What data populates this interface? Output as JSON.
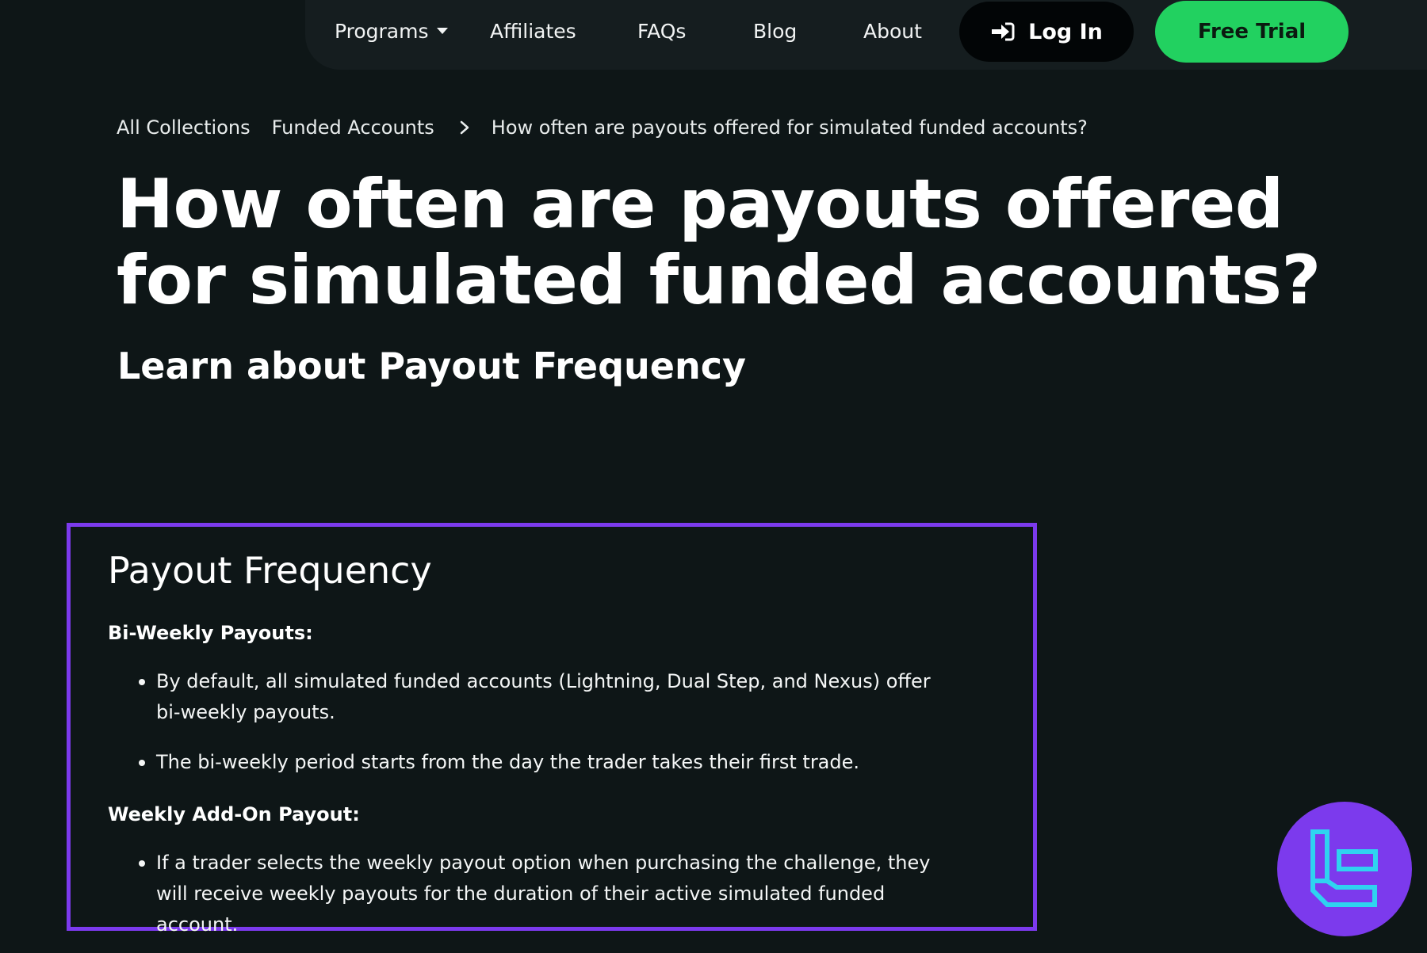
{
  "nav": {
    "items": [
      {
        "label": "Programs",
        "has_dropdown": true
      },
      {
        "label": "Affiliates"
      },
      {
        "label": "FAQs"
      },
      {
        "label": "Blog"
      },
      {
        "label": "About"
      }
    ],
    "login_label": "Log In",
    "login_icon": "sign-in-icon",
    "trial_label": "Free Trial"
  },
  "breadcrumb": {
    "items": [
      "All Collections",
      "Funded Accounts"
    ],
    "separator_icon": "chevron-right-icon",
    "current": "How often are payouts offered for simulated funded accounts?"
  },
  "article": {
    "title": "How often are payouts offered for simulated funded accounts?",
    "subtitle": "Learn about Payout Frequency",
    "section": {
      "title": "Payout Frequency",
      "groups": [
        {
          "heading": "Bi-Weekly Payouts:",
          "bullets": [
            "By default, all simulated funded accounts (Lightning, Dual Step, and Nexus) offer bi-weekly payouts.",
            "The bi-weekly period starts from the day the trader takes their first trade."
          ]
        },
        {
          "heading": "Weekly Add-On Payout:",
          "bullets": [
            "If a trader selects the weekly payout option when purchasing the challenge, they will receive weekly payouts for the duration of their active simulated funded account."
          ]
        }
      ]
    }
  },
  "colors": {
    "background": "#0e1617",
    "nav_bar": "#151d1f",
    "login_button": "#020506",
    "trial_button": "#22d160",
    "highlight_border": "#7c3aed",
    "logo_badge": "#7c3aed",
    "logo_mark": "#2fd3f0"
  },
  "logo": {
    "icon": "tc-logo-icon"
  }
}
